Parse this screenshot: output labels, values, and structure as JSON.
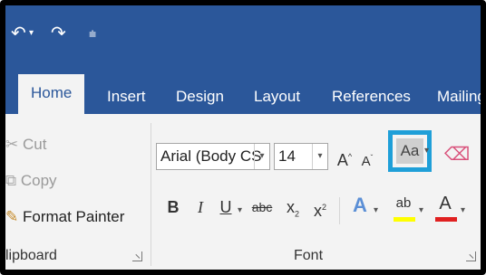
{
  "qat": {
    "undo": "↶",
    "redo": "↷",
    "customize": "⩧"
  },
  "tabs": [
    {
      "label": "Home",
      "active": true
    },
    {
      "label": "Insert"
    },
    {
      "label": "Design"
    },
    {
      "label": "Layout"
    },
    {
      "label": "References"
    },
    {
      "label": "Mailing"
    }
  ],
  "clipboard": {
    "cut": "Cut",
    "copy": "Copy",
    "format_painter": "Format Painter",
    "group_label": "lipboard"
  },
  "font": {
    "font_name": "Arial (Body CS",
    "font_size": "14",
    "grow": "A",
    "shrink": "A",
    "change_case": "Aa",
    "bold": "B",
    "italic": "I",
    "underline": "U",
    "strike": "abc",
    "subscript": "x",
    "sub_mark": "2",
    "superscript": "x",
    "sup_mark": "2",
    "text_effects": "A",
    "highlight": "ab",
    "font_color": "A",
    "group_label": "Font"
  },
  "colors": {
    "ribbon_blue": "#2b579a",
    "highlight_yellow": "#ffff00",
    "font_red": "#e02020",
    "focus_box": "#1f9fd8"
  }
}
